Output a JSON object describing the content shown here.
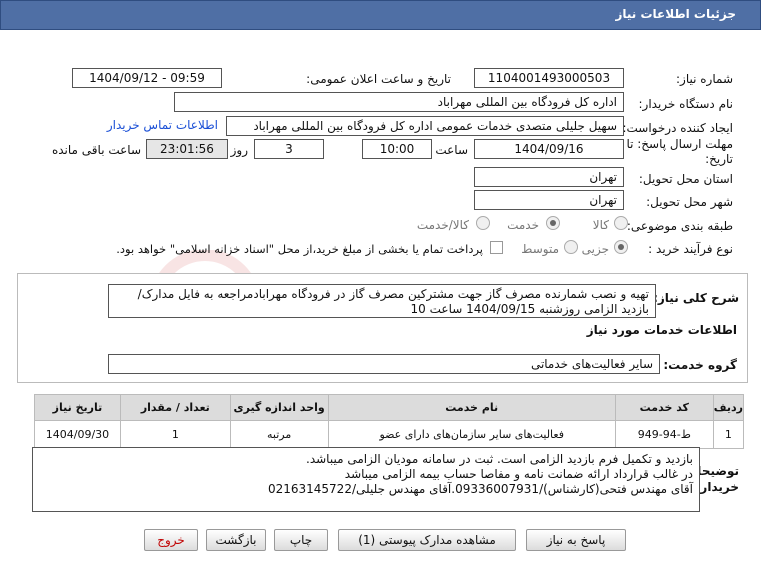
{
  "header": {
    "title": "جزئیات اطلاعات نیاز"
  },
  "form": {
    "need_number_label": "شماره نیاز:",
    "need_number": "1104001493000503",
    "announce_label": "تاریخ و ساعت اعلان عمومی:",
    "announce_value": "1404/09/12 - 09:59",
    "buyer_org_label": "نام دستگاه خریدار:",
    "buyer_org": "اداره کل فرودگاه بین المللی مهراباد",
    "creator_label": "ایجاد کننده درخواست:",
    "creator": "سهیل جلیلی متصدی خدمات عمومی اداره کل فرودگاه بین المللی مهراباد",
    "contact_link": "اطلاعات تماس خریدار",
    "deadline_label_line1": "مهلت ارسال پاسخ: تا",
    "deadline_label_line2": "تاریخ:",
    "deadline_date": "1404/09/16",
    "time_label": "ساعت",
    "deadline_time": "10:00",
    "days_value": "3",
    "days_label": "روز و",
    "remaining_time": "23:01:56",
    "remaining_label": "ساعت باقی مانده",
    "province_label": "استان محل تحویل:",
    "province": "تهران",
    "city_label": "شهر محل تحویل:",
    "city": "تهران",
    "category_label": "طبقه بندی موضوعی:",
    "category_options": [
      "کالا",
      "خدمت",
      "کالا/خدمت"
    ],
    "process_label": "نوع فرآیند خرید :",
    "process_options": [
      "جزیی",
      "متوسط"
    ],
    "payment_note": "پرداخت تمام یا بخشی از مبلغ خرید،از محل \"اسناد خزانه اسلامی\" خواهد بود."
  },
  "description": {
    "label": "شرح کلی نیاز:",
    "text": "تهیه و نصب شمارنده مصرف گاز جهت مشترکین مصرف گاز در فرودگاه مهرابادمراجعه به فایل مدارک/بازدید الزامی روزشنبه 1404/09/15 ساعت 10"
  },
  "services": {
    "section_title": "اطلاعات خدمات مورد نیاز",
    "group_label": "گروه خدمت:",
    "group_value": "سایر فعالیت‌های خدماتی",
    "columns": [
      "ردیف",
      "کد خدمت",
      "نام خدمت",
      "واحد اندازه گیری",
      "تعداد / مقدار",
      "تاریخ نیاز"
    ],
    "rows": [
      {
        "row": "1",
        "code": "ط-94-949",
        "name": "فعالیت‌های سایر سازمان‌های دارای عضو",
        "unit": "مرتبه",
        "qty": "1",
        "date": "1404/09/30"
      }
    ]
  },
  "buyer_notes": {
    "label_line1": "توضیحات",
    "label_line2": "خریدار:",
    "lines": [
      "بازدید و تکمیل فرم بازدید الزامی است. ثبت در سامانه مودیان الزامی میباشد.",
      "در غالب قرارداد ارائه ضمانت نامه و مفاصا حساب بیمه الزامی میباشد",
      "آقای مهندس فتحی(کارشناس)/09336007931.آقای مهندس جلیلی/02163145722"
    ]
  },
  "buttons": {
    "reply": "پاسخ به نیاز",
    "view_docs": "مشاهده مدارک پیوستی (1)",
    "print": "چاپ",
    "back": "بازگشت",
    "exit": "خروج"
  },
  "watermark": {
    "text": "AriaTender.neT"
  },
  "colors": {
    "header": "#4f6fa5",
    "link": "#1a4fd6",
    "exit_text": "#c00000"
  }
}
